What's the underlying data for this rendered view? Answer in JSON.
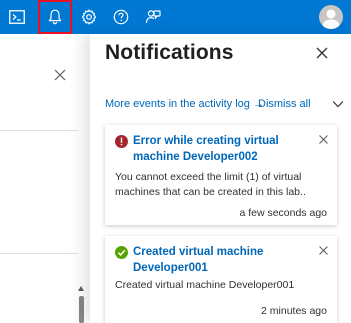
{
  "topbar": {
    "icons": [
      "cloud-shell-icon",
      "bell-icon",
      "gear-icon",
      "help-icon",
      "feedback-icon",
      "avatar-icon"
    ],
    "accent": "#0078d4",
    "highlight": "#e81123"
  },
  "notifications": {
    "title": "Notifications",
    "activity_log_link": "More events in the activity log →",
    "dismiss_all": "Dismiss all",
    "items": [
      {
        "status": "error",
        "title": "Error while creating virtual machine Developer002",
        "body": "You cannot exceed the limit (1) of virtual machines that can be created in this lab..",
        "time": "a few seconds ago"
      },
      {
        "status": "success",
        "title": "Created virtual machine Developer001",
        "body": "Created virtual machine Developer001",
        "time": "2 minutes ago"
      }
    ]
  },
  "colors": {
    "error": "#a4262c",
    "success": "#57a300",
    "link": "#0067b8"
  }
}
